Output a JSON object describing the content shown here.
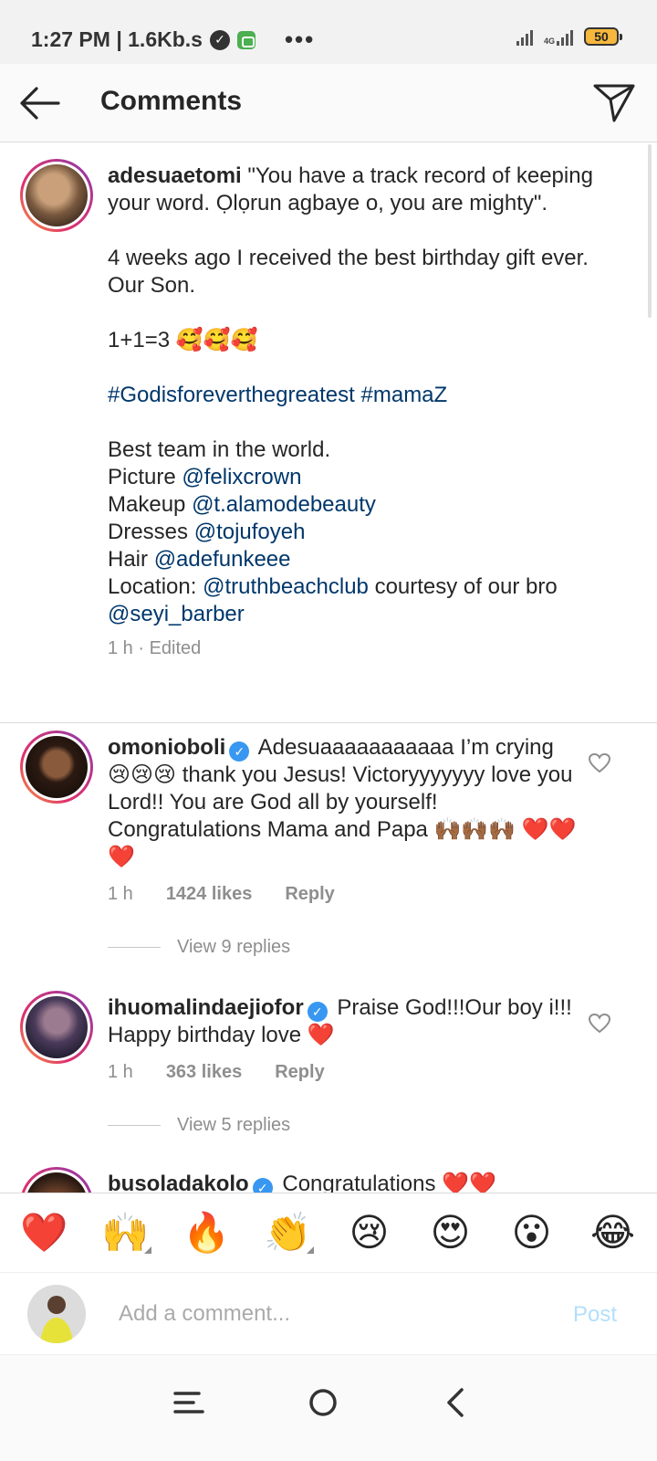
{
  "status_bar": {
    "time_speed": "1:27 PM | 1.6Kb.s",
    "network_label": "4G",
    "battery": "50"
  },
  "header": {
    "title": "Comments"
  },
  "caption": {
    "username": "adesuaetomi",
    "line1": "\"You have a track record of keeping your word. Ọlọrun agbaye o, you are mighty\".",
    "line2": "4 weeks ago I received the best birthday gift ever. Our Son.",
    "line3": "1+1=3 🥰🥰🥰",
    "hashtag1": "#Godisforeverthegreatest",
    "hashtag2": "#mamaZ",
    "team": "Best team in the world.",
    "credits": [
      {
        "label": "Picture",
        "handle": "@felixcrown"
      },
      {
        "label": "Makeup",
        "handle": "@t.alamodebeauty"
      },
      {
        "label": "Dresses",
        "handle": "@tojufoyeh"
      },
      {
        "label": "Hair",
        "handle": "@adefunkeee"
      }
    ],
    "location_label": "Location:",
    "location_handle": "@truthbeachclub",
    "location_suffix": "courtesy of our bro",
    "bro_handle": "@seyi_barber",
    "meta": "1 h · Edited"
  },
  "comments": [
    {
      "username": "omonioboli",
      "text": "Adesuaaaaaaaaaaa I’m crying 😢😢😢 thank you Jesus! Victoryyyyyyy love you Lord!! You are God all by yourself! Congratulations Mama and Papa 🙌🏾🙌🏾🙌🏾 ❤️❤️❤️",
      "time": "1 h",
      "likes": "1424 likes",
      "reply": "Reply",
      "view_replies": "View 9 replies"
    },
    {
      "username": "ihuomalindaejiofor",
      "text": "Praise God!!!Our boy i!!! Happy birthday love ❤️",
      "time": "1 h",
      "likes": "363 likes",
      "reply": "Reply",
      "view_replies": "View 5 replies"
    },
    {
      "username": "busoladakolo",
      "text": "Congratulations ❤️❤️"
    }
  ],
  "emoji_bar": [
    "❤️",
    "🙌",
    "🔥",
    "👏",
    "😢",
    "😍",
    "😮",
    "😂"
  ],
  "comment_box": {
    "placeholder": "Add a comment...",
    "post_label": "Post"
  },
  "colors": {
    "link": "#00376b",
    "verified": "#3897f0",
    "post_disabled": "#b2dffc",
    "meta_gray": "#8e8e8e"
  }
}
